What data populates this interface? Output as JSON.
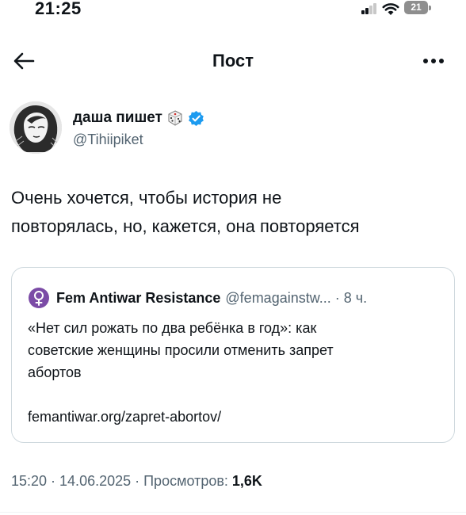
{
  "status_bar": {
    "time": "21:25",
    "battery": "21"
  },
  "header": {
    "title": "Пост"
  },
  "tweet": {
    "author_name": "даша пишет",
    "author_handle": "@Tihiipiket",
    "text_line1": "Очень хочется, чтобы история не",
    "text_line2": "повторялась, но, кажется, она повторяется",
    "timestamp": "15:20 · 14.06.2025 · Просмотров: ",
    "views": "1,6K"
  },
  "quote": {
    "name": "Fem Antiwar Resistance",
    "handle": "@femagainstw... · 8 ч.",
    "text_line1": "«Нет сил рожать по два ребёнка в год»: как",
    "text_line2": "советские женщины просили отменить запрет",
    "text_line3": "абортов",
    "link": "femantiwar.org/zapret-abortov/"
  },
  "icons": {
    "back": "back-arrow-icon",
    "more": "more-icon",
    "verified": "verified-badge-icon",
    "dice": "dice-icon",
    "venus": "venus-icon",
    "signal": "signal-icon",
    "wifi": "wifi-icon",
    "battery": "battery-icon"
  },
  "colors": {
    "verified": "#1d9bf0",
    "secondary_text": "#536471",
    "venus_badge": "#7b4ba6"
  }
}
